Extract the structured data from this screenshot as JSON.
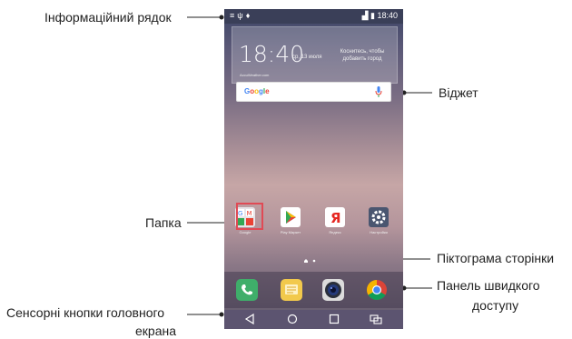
{
  "callouts": {
    "status_bar": "Інформаційний рядок",
    "widget": "Віджет",
    "folder": "Папка",
    "page_icon": "Піктограма сторінки",
    "quick_access_line1": "Панель швидкого",
    "quick_access_line2": "доступу",
    "home_touch_buttons_line1": "Сенсорні кнопки головного",
    "home_touch_buttons_line2": "екрана"
  },
  "status_bar": {
    "time": "18:40"
  },
  "weather_widget": {
    "time": "18:40",
    "date": "ср, 13 июля",
    "location_hint": "Коснитесь, чтобы добавить город",
    "source": "AccuWeather.com"
  },
  "search_widget": {
    "logo": "Google"
  },
  "apps": [
    {
      "name": "Google",
      "icon": "google-folder-icon"
    },
    {
      "name": "Play Маркет",
      "icon": "play-store-icon"
    },
    {
      "name": "Яндекс",
      "icon": "yandex-icon"
    },
    {
      "name": "Настройки",
      "icon": "settings-icon"
    }
  ],
  "dock": [
    {
      "icon": "phone-icon"
    },
    {
      "icon": "messages-icon"
    },
    {
      "icon": "camera-icon"
    },
    {
      "icon": "chrome-icon"
    }
  ],
  "navigation": [
    {
      "icon": "back-icon"
    },
    {
      "icon": "home-icon"
    },
    {
      "icon": "recent-apps-icon"
    },
    {
      "icon": "dual-window-icon"
    }
  ],
  "colors": {
    "highlight": "#e04a55",
    "callout_line": "#222222"
  }
}
